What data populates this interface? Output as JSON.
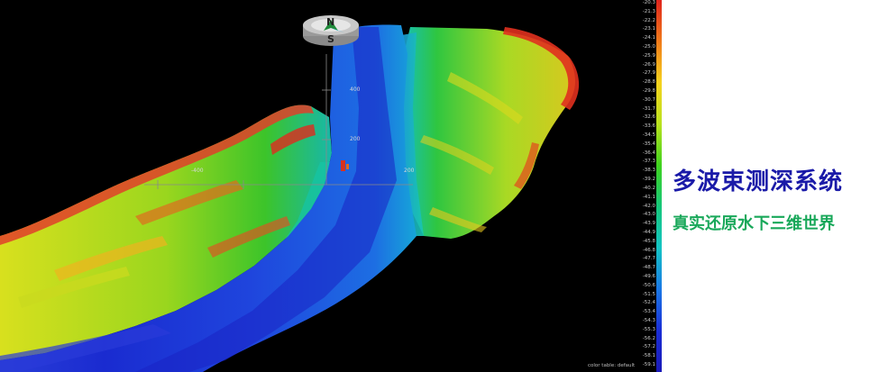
{
  "viewer": {
    "compass": {
      "north_label": "N",
      "south_label": "S"
    },
    "axis_labels": [
      "400",
      "200",
      "-400",
      "200"
    ],
    "color_table_label": "color table: default",
    "depth_scale": [
      "-20.3",
      "-21.3",
      "-22.2",
      "-23.1",
      "-24.1",
      "-25.0",
      "-25.9",
      "-26.9",
      "-27.9",
      "-28.8",
      "-29.8",
      "-30.7",
      "-31.7",
      "-32.6",
      "-33.6",
      "-34.5",
      "-35.4",
      "-36.4",
      "-37.3",
      "-38.3",
      "-39.2",
      "-40.2",
      "-41.1",
      "-42.0",
      "-43.0",
      "-43.9",
      "-44.9",
      "-45.8",
      "-46.8",
      "-47.7",
      "-48.7",
      "-49.6",
      "-50.6",
      "-51.5",
      "-52.4",
      "-53.4",
      "-54.3",
      "-55.3",
      "-56.2",
      "-57.2",
      "-58.1",
      "-59.1"
    ],
    "colorbar_colors": [
      "#e0241d",
      "#f07a1a",
      "#f6d21e",
      "#b9e21e",
      "#3fd21e",
      "#16c77a",
      "#14c4c4",
      "#1a78e6",
      "#1a2ed6",
      "#1a1ab8"
    ]
  },
  "title": {
    "main": "多波束测深系统",
    "sub": "真实还原水下三维世界",
    "main_color": "#1a1aa8",
    "sub_color": "#19a85a"
  }
}
